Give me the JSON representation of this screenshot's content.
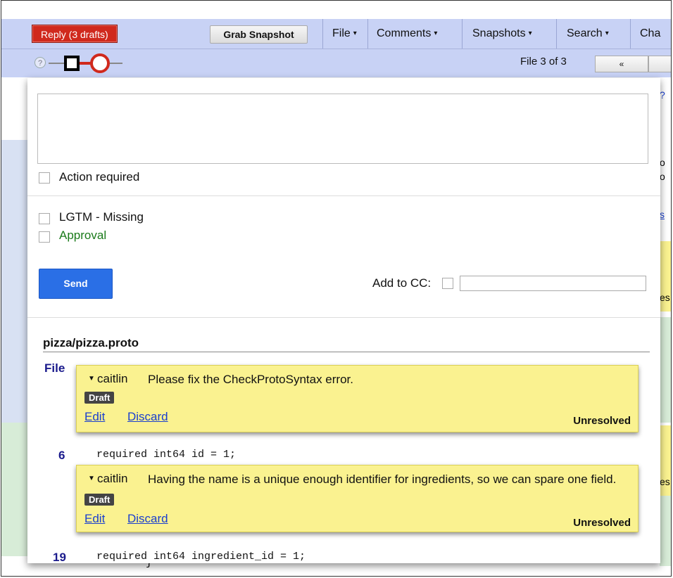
{
  "toolbar": {
    "reply_label": "Reply (3 drafts)",
    "grab_label": "Grab Snapshot",
    "menus": [
      {
        "label": "File"
      },
      {
        "label": "Comments"
      },
      {
        "label": "Snapshots"
      },
      {
        "label": "Search"
      },
      {
        "label": "Cha"
      }
    ],
    "caret": "▾"
  },
  "subbar": {
    "help_glyph": "?",
    "file_count": "File 3 of 3",
    "prev_label": "«"
  },
  "peek": {
    "right_texts": [
      "?",
      "o",
      "o",
      "s",
      "es",
      "es"
    ],
    "closing_brace": "}"
  },
  "reply_panel": {
    "action_required_label": "Action required",
    "lgtm_label": "LGTM - Missing",
    "approval_label": "Approval",
    "send_label": "Send",
    "cc_label": "Add to CC:"
  },
  "file_section": {
    "path": "pizza/pizza.proto",
    "file_label": "File",
    "comments": [
      {
        "author": "caitlin",
        "text": "Please fix the CheckProtoSyntax error.",
        "badge": "Draft",
        "edit_label": "Edit",
        "discard_label": "Discard",
        "status": "Unresolved"
      },
      {
        "author": "caitlin",
        "text": "Having the name is a unique enough identifier for ingredients, so we can spare one field.",
        "badge": "Draft",
        "edit_label": "Edit",
        "discard_label": "Discard",
        "status": "Unresolved"
      }
    ],
    "lines": [
      {
        "num": "6",
        "code": "required int64 id = 1;"
      },
      {
        "num": "19",
        "code": "required int64 ingredient_id = 1;"
      }
    ]
  },
  "colors": {
    "reply_red": "#d0291d",
    "toolbar_blue": "#c8d2f5",
    "send_blue": "#2a6fe6",
    "comment_yellow": "#faf290",
    "approval_green": "#1a7a1a"
  }
}
